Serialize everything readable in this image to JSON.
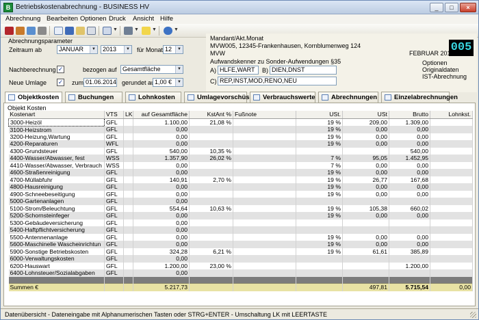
{
  "window": {
    "title": "Betriebskostenabrechnung - BUSINESS HV",
    "app_icon": "B"
  },
  "window_controls": {
    "minimize": "_",
    "maximize": "□",
    "close": "×"
  },
  "menu": [
    "Abrechnung",
    "Bearbeiten",
    "Optionen",
    "Druck",
    "Ansicht",
    "Hilfe"
  ],
  "toolbar_icons": [
    "calculator-icon",
    "edit-settings-icon",
    "refresh-icon",
    "stop-icon",
    "cut-icon",
    "copy-icon",
    "paste-icon",
    "find-icon",
    "columns-icon",
    "print-icon",
    "note-icon",
    "help-icon"
  ],
  "params": {
    "group_title": "Abrechnungsparameter",
    "zeitraum_label": "Zeitraum ab",
    "month": "JANUAR",
    "year": "2013",
    "months_label": "für Monate",
    "months": "12",
    "nachberechnung_label": "Nachberechnung",
    "bezogen_label": "bezogen auf",
    "bezogen_value": "Gesamtfläche",
    "neue_umlage_label": "Neue Umlage",
    "zum_label": "zum",
    "date": "01.06.2014",
    "gerundet_label": "gerundet auf",
    "rounding": "1,00 €",
    "check_mark": "✓"
  },
  "mandant": {
    "header": "Mandant/Akt.Monat",
    "line1": "MVW005, 12345-Frankenhausen, Kornblumenweg 124",
    "line2": "MVW",
    "period": "FEBRUAR 2014",
    "badge": "005"
  },
  "aufwand": {
    "header": "Aufwandskenner zu Sonder-Aufwendungen §35",
    "a_label": "A)",
    "a_value": "HLFE,WART",
    "b_label": "B)",
    "b_value": "DIEN,DNST",
    "c_label": "C)",
    "c_value": "REP,INST,MOD,RENO,NEU"
  },
  "options": {
    "title": "Optionen",
    "line1": "Originaldaten",
    "line2": "IST-Abrechnung"
  },
  "tabs": [
    "Objektkosten",
    "Buchungen",
    "Lohnkosten",
    "Umlagevorschüsse",
    "Verbrauchswerte",
    "Abrechnungen",
    "Einzelabrechnungen"
  ],
  "grid": {
    "section_label": "Objekt Kosten",
    "columns": [
      "Kostenart",
      "VTS",
      "LK",
      "auf Gesamtfläche",
      "KstAnt %",
      "Fußnote",
      "USt.",
      "USt",
      "Brutto",
      "Lohnkst."
    ],
    "rows": [
      [
        "3000-Heizöl",
        "GFL",
        "",
        "1.100,00",
        "21,08 %",
        "",
        "19 %",
        "209,00",
        "1.309,00",
        ""
      ],
      [
        "3100-Heizstrom",
        "GFL",
        "",
        "0,00",
        "",
        "",
        "19 %",
        "0,00",
        "0,00",
        ""
      ],
      [
        "3200-Heizung,Wartung",
        "GFL",
        "",
        "0,00",
        "",
        "",
        "19 %",
        "0,00",
        "0,00",
        ""
      ],
      [
        "4200-Reparaturen",
        "WFL",
        "",
        "0,00",
        "",
        "",
        "19 %",
        "0,00",
        "0,00",
        ""
      ],
      [
        "4300-Grundsteuer",
        "GFL",
        "",
        "540,00",
        "10,35 %",
        "",
        "",
        "",
        "540,00",
        ""
      ],
      [
        "4400-Wasser/Abwasser, fest",
        "WSS",
        "",
        "1.357,90",
        "26,02 %",
        "",
        "7 %",
        "95,05",
        "1.452,95",
        ""
      ],
      [
        "4410-Wasser/Abwasser, Verbrauch",
        "WSS",
        "",
        "0,00",
        "",
        "",
        "7 %",
        "0,00",
        "0,00",
        ""
      ],
      [
        "4600-Straßenreinigung",
        "GFL",
        "",
        "0,00",
        "",
        "",
        "19 %",
        "0,00",
        "0,00",
        ""
      ],
      [
        "4700-Müllabfuhr",
        "GFL",
        "",
        "140,91",
        "2,70 %",
        "",
        "19 %",
        "26,77",
        "167,68",
        ""
      ],
      [
        "4800-Hausreinigung",
        "GFL",
        "",
        "0,00",
        "",
        "",
        "19 %",
        "0,00",
        "0,00",
        ""
      ],
      [
        "4900-Schneebeseitigung",
        "GFL",
        "",
        "0,00",
        "",
        "",
        "19 %",
        "0,00",
        "0,00",
        ""
      ],
      [
        "5000-Gartenanlagen",
        "GFL",
        "",
        "0,00",
        "",
        "",
        "",
        "",
        "",
        ""
      ],
      [
        "5100-Strom/Beleuchtung",
        "GFL",
        "",
        "554,64",
        "10,63 %",
        "",
        "19 %",
        "105,38",
        "660,02",
        ""
      ],
      [
        "5200-Schornsteinfeger",
        "GFL",
        "",
        "0,00",
        "",
        "",
        "19 %",
        "0,00",
        "0,00",
        ""
      ],
      [
        "5300-Gebäudeversicherung",
        "GFL",
        "",
        "0,00",
        "",
        "",
        "",
        "",
        "",
        ""
      ],
      [
        "5400-Haftpflichtversicherung",
        "GFL",
        "",
        "0,00",
        "",
        "",
        "",
        "",
        "",
        ""
      ],
      [
        "5500-Antennenanlage",
        "GFL",
        "",
        "0,00",
        "",
        "",
        "19 %",
        "0,00",
        "0,00",
        ""
      ],
      [
        "5600-Maschinelle Wascheinrichtun",
        "GFL",
        "",
        "0,00",
        "",
        "",
        "19 %",
        "0,00",
        "0,00",
        ""
      ],
      [
        "5900-Sonstige Betriebskosten",
        "GFL",
        "",
        "324,28",
        "6,21 %",
        "",
        "19 %",
        "61,61",
        "385,89",
        ""
      ],
      [
        "6000-Verwaltungskosten",
        "GFL",
        "",
        "0,00",
        "",
        "",
        "",
        "",
        "",
        ""
      ],
      [
        "6200-Hauswart",
        "GFL",
        "",
        "1.200,00",
        "23,00 %",
        "",
        "",
        "",
        "1.200,00",
        ""
      ],
      [
        "6400-Lohnsteuer/Sozialabgaben",
        "GFL",
        "",
        "0,00",
        "",
        "",
        "",
        "",
        "",
        ""
      ]
    ],
    "sum": [
      "Summen €",
      "",
      "",
      "5.217,73",
      "",
      "",
      "",
      "497,81",
      "5.715,54",
      "0,00"
    ]
  },
  "status": "Datenübersicht - Dateneingabe mit Alphanumerischen Tasten oder STRG+ENTER - Umschaltung LK mit LEERTASTE"
}
